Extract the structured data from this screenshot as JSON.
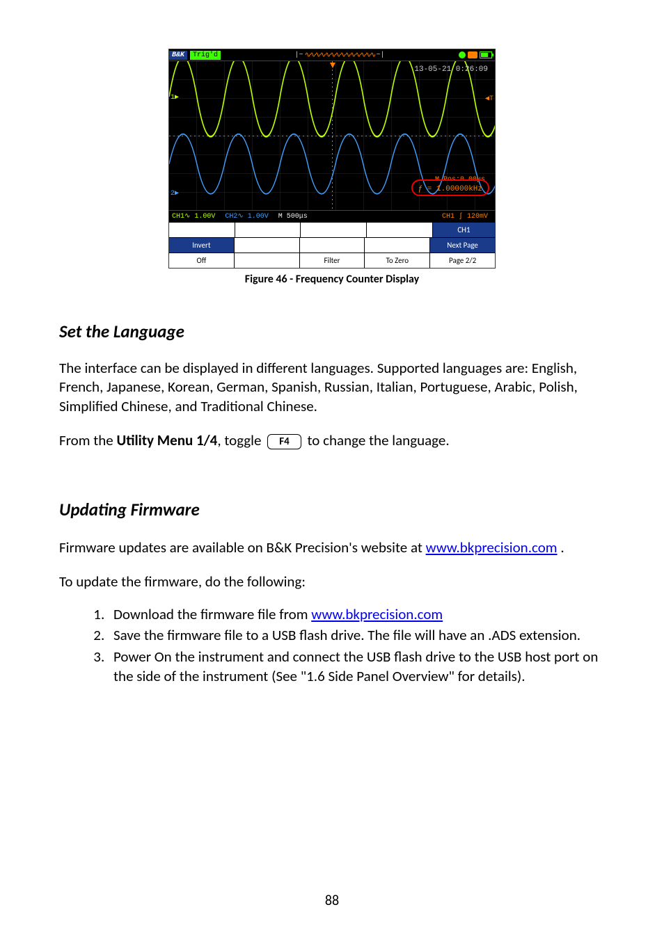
{
  "scope": {
    "brand": "B&K",
    "trig_status": "Trig'd",
    "datetime": "13-05-21 0:26:09",
    "marker1": "1▶",
    "marker2": "2▶",
    "markerT": "◀T",
    "pos_label": "M Pos:0.00μs",
    "freq_val": "ƒ = 1.00000kHz",
    "ch1": "CH1∿ 1.00V",
    "ch2": "CH2∿ 1.00V",
    "timebase": "M 500μs",
    "trig_src": "CH1 ∫ 120mV",
    "menu": {
      "ch1_tag": "CH1",
      "invert": "Invert",
      "off": "Off",
      "filter": "Filter",
      "tozero": "To Zero",
      "nextpage": "Next Page",
      "page": "Page 2/2"
    }
  },
  "figure_caption": "Figure 46 - Frequency Counter Display",
  "section1": {
    "heading": "Set the Language",
    "para": "The interface can be displayed in different languages.  Supported languages are:  English, French, Japanese, Korean, German, Spanish, Russian, Italian, Portuguese, Arabic, Polish, Simplified Chinese, and Traditional Chinese.",
    "line2_pre": "From the ",
    "line2_bold": "Utility Menu 1/4",
    "line2_mid": ", toggle ",
    "key": "F4",
    "line2_post": " to change the language."
  },
  "section2": {
    "heading": "Updating Firmware",
    "para1_pre": "Firmware updates are available on B&K Precision's website at ",
    "link1": "www.bkprecision.com",
    "para1_post": " .",
    "para2": "To update the firmware, do the following:",
    "steps": {
      "s1_pre": "Download the firmware file from ",
      "s1_link": "www.bkprecision.com",
      "s2": "Save the firmware file to a USB flash drive.  The file will have an .ADS extension.",
      "s3": "Power On the instrument and connect the USB flash drive to the USB host port on the side of the instrument (See \"1.6 Side Panel Overview\" for details)."
    }
  },
  "page_number": "88"
}
